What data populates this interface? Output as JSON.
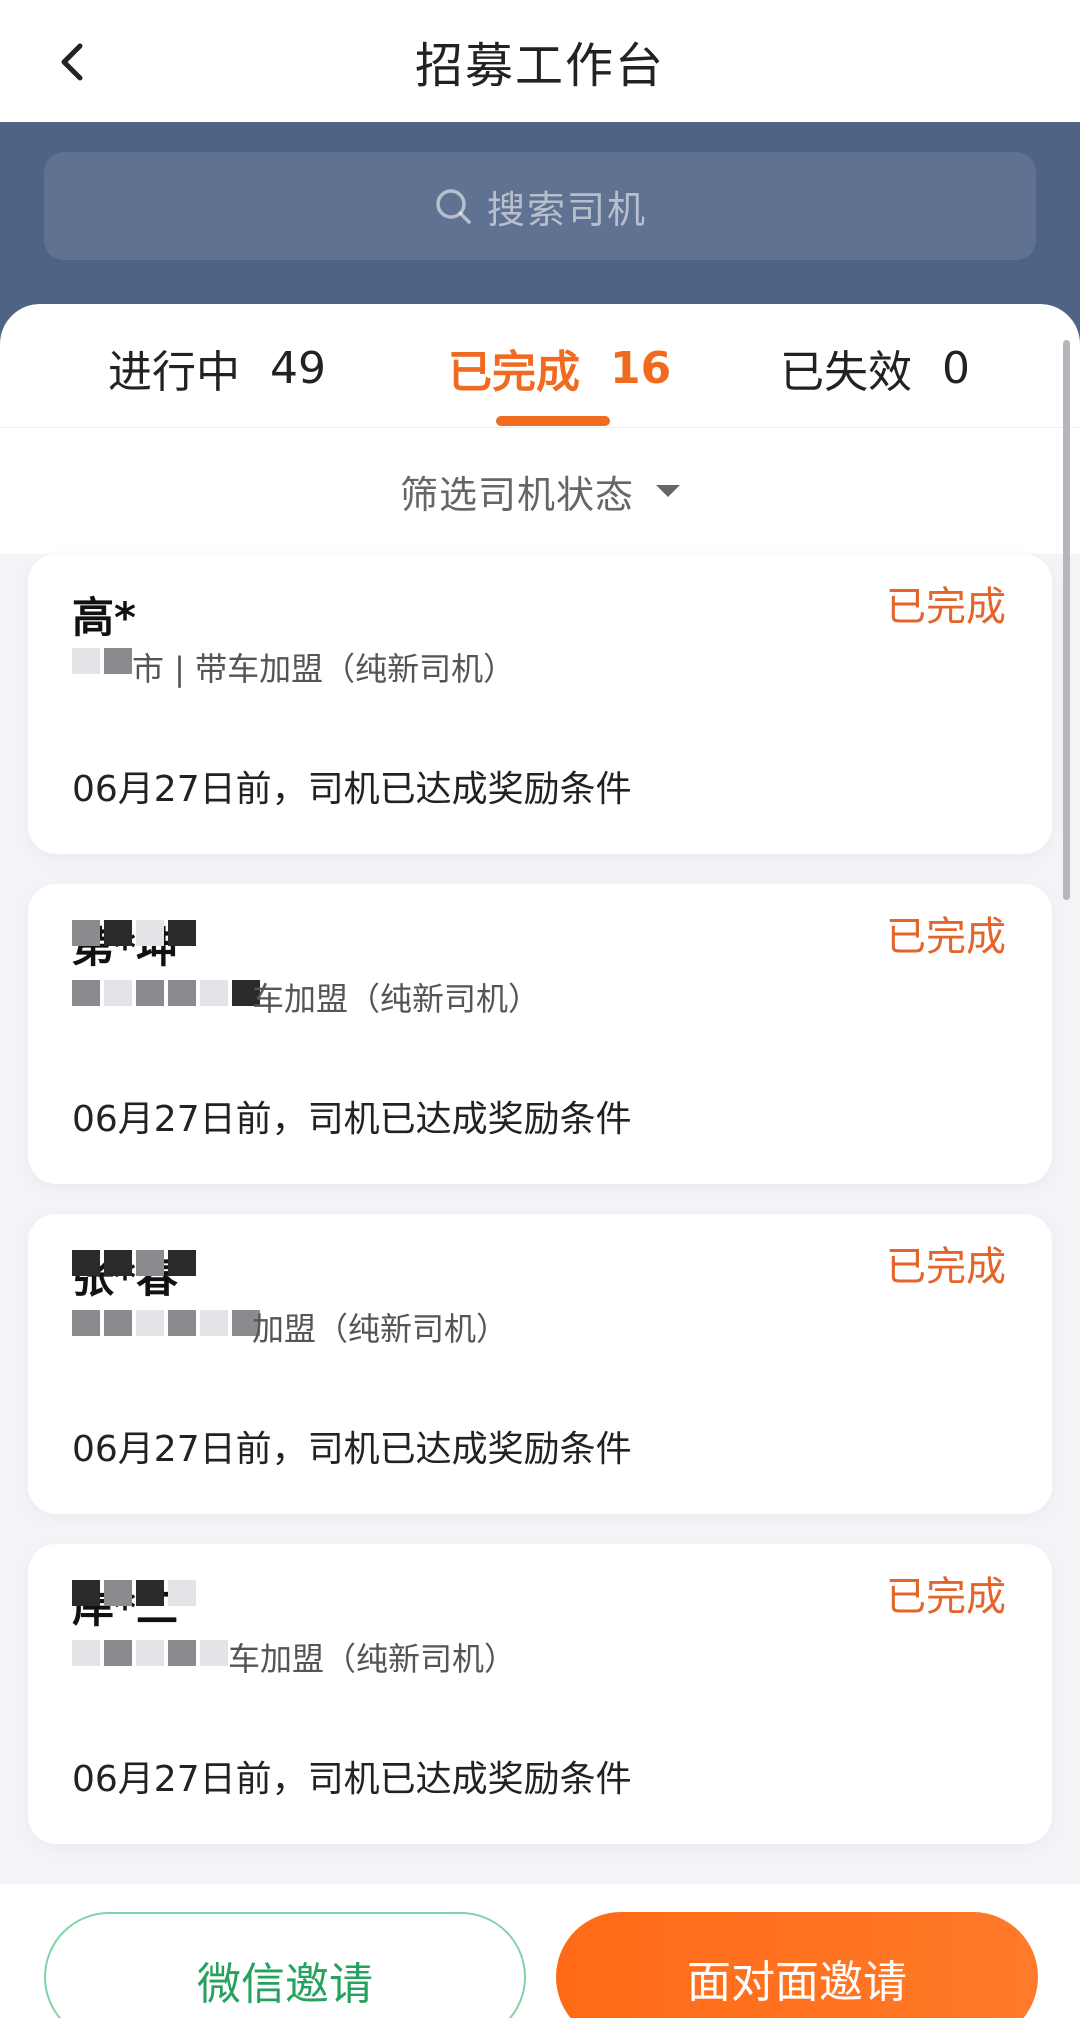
{
  "header": {
    "title": "招募工作台",
    "back_icon": "chevron-left-icon"
  },
  "search": {
    "placeholder": "搜索司机",
    "icon": "search-icon"
  },
  "tabs": [
    {
      "label": "进行中",
      "count": "49",
      "active": false
    },
    {
      "label": "已完成",
      "count": "16",
      "active": true
    },
    {
      "label": "已失效",
      "count": "0",
      "active": false
    }
  ],
  "filter": {
    "label": "筛选司机状态",
    "icon": "caret-down-icon"
  },
  "drivers": [
    {
      "name": "高*",
      "status": "已完成",
      "subtitle": "市 | 带车加盟（纯新司机）",
      "note": "06月27日前，司机已达成奖励条件"
    },
    {
      "name": "苐*坤",
      "status": "已完成",
      "subtitle": "车加盟（纯新司机）",
      "note": "06月27日前，司机已达成奖励条件"
    },
    {
      "name": "张*春",
      "status": "已完成",
      "subtitle": "加盟（纯新司机）",
      "note": "06月27日前，司机已达成奖励条件"
    },
    {
      "name": "岸*二",
      "status": "已完成",
      "subtitle": "车加盟（纯新司机）",
      "note": "06月27日前，司机已达成奖励条件"
    }
  ],
  "actions": {
    "wechat_invite": "微信邀请",
    "face_invite": "面对面邀请"
  },
  "colors": {
    "accent": "#f06a20",
    "header_bg": "#4f6385",
    "wechat_green": "#27a25e"
  }
}
